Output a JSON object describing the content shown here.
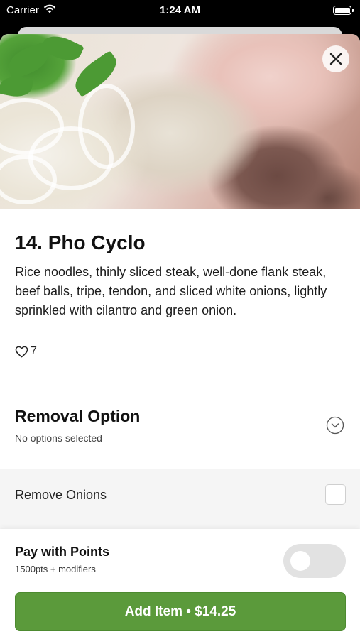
{
  "status_bar": {
    "carrier": "Carrier",
    "time": "1:24 AM"
  },
  "item": {
    "title": "14. Pho Cyclo",
    "description": "Rice noodles, thinly sliced steak, well-done flank steak, beef balls, tripe, tendon, and sliced white onions, lightly sprinkled with cilantro and green onion.",
    "likes": "7"
  },
  "removal_option": {
    "title": "Removal Option",
    "subtitle": "No options selected",
    "options": [
      {
        "label": "Remove Onions",
        "checked": false
      }
    ]
  },
  "points": {
    "title": "Pay with Points",
    "subtitle": "1500pts + modifiers",
    "enabled": false
  },
  "add_button": {
    "label": "Add Item • $14.25"
  },
  "colors": {
    "accent": "#5b9a3b",
    "toggle_off": "#e2e2e2",
    "option_bg": "#f5f5f5"
  },
  "icons": {
    "close": "close-icon",
    "chevron": "chevron-down-icon",
    "heart": "heart-icon",
    "wifi": "wifi-icon",
    "battery": "battery-icon"
  }
}
